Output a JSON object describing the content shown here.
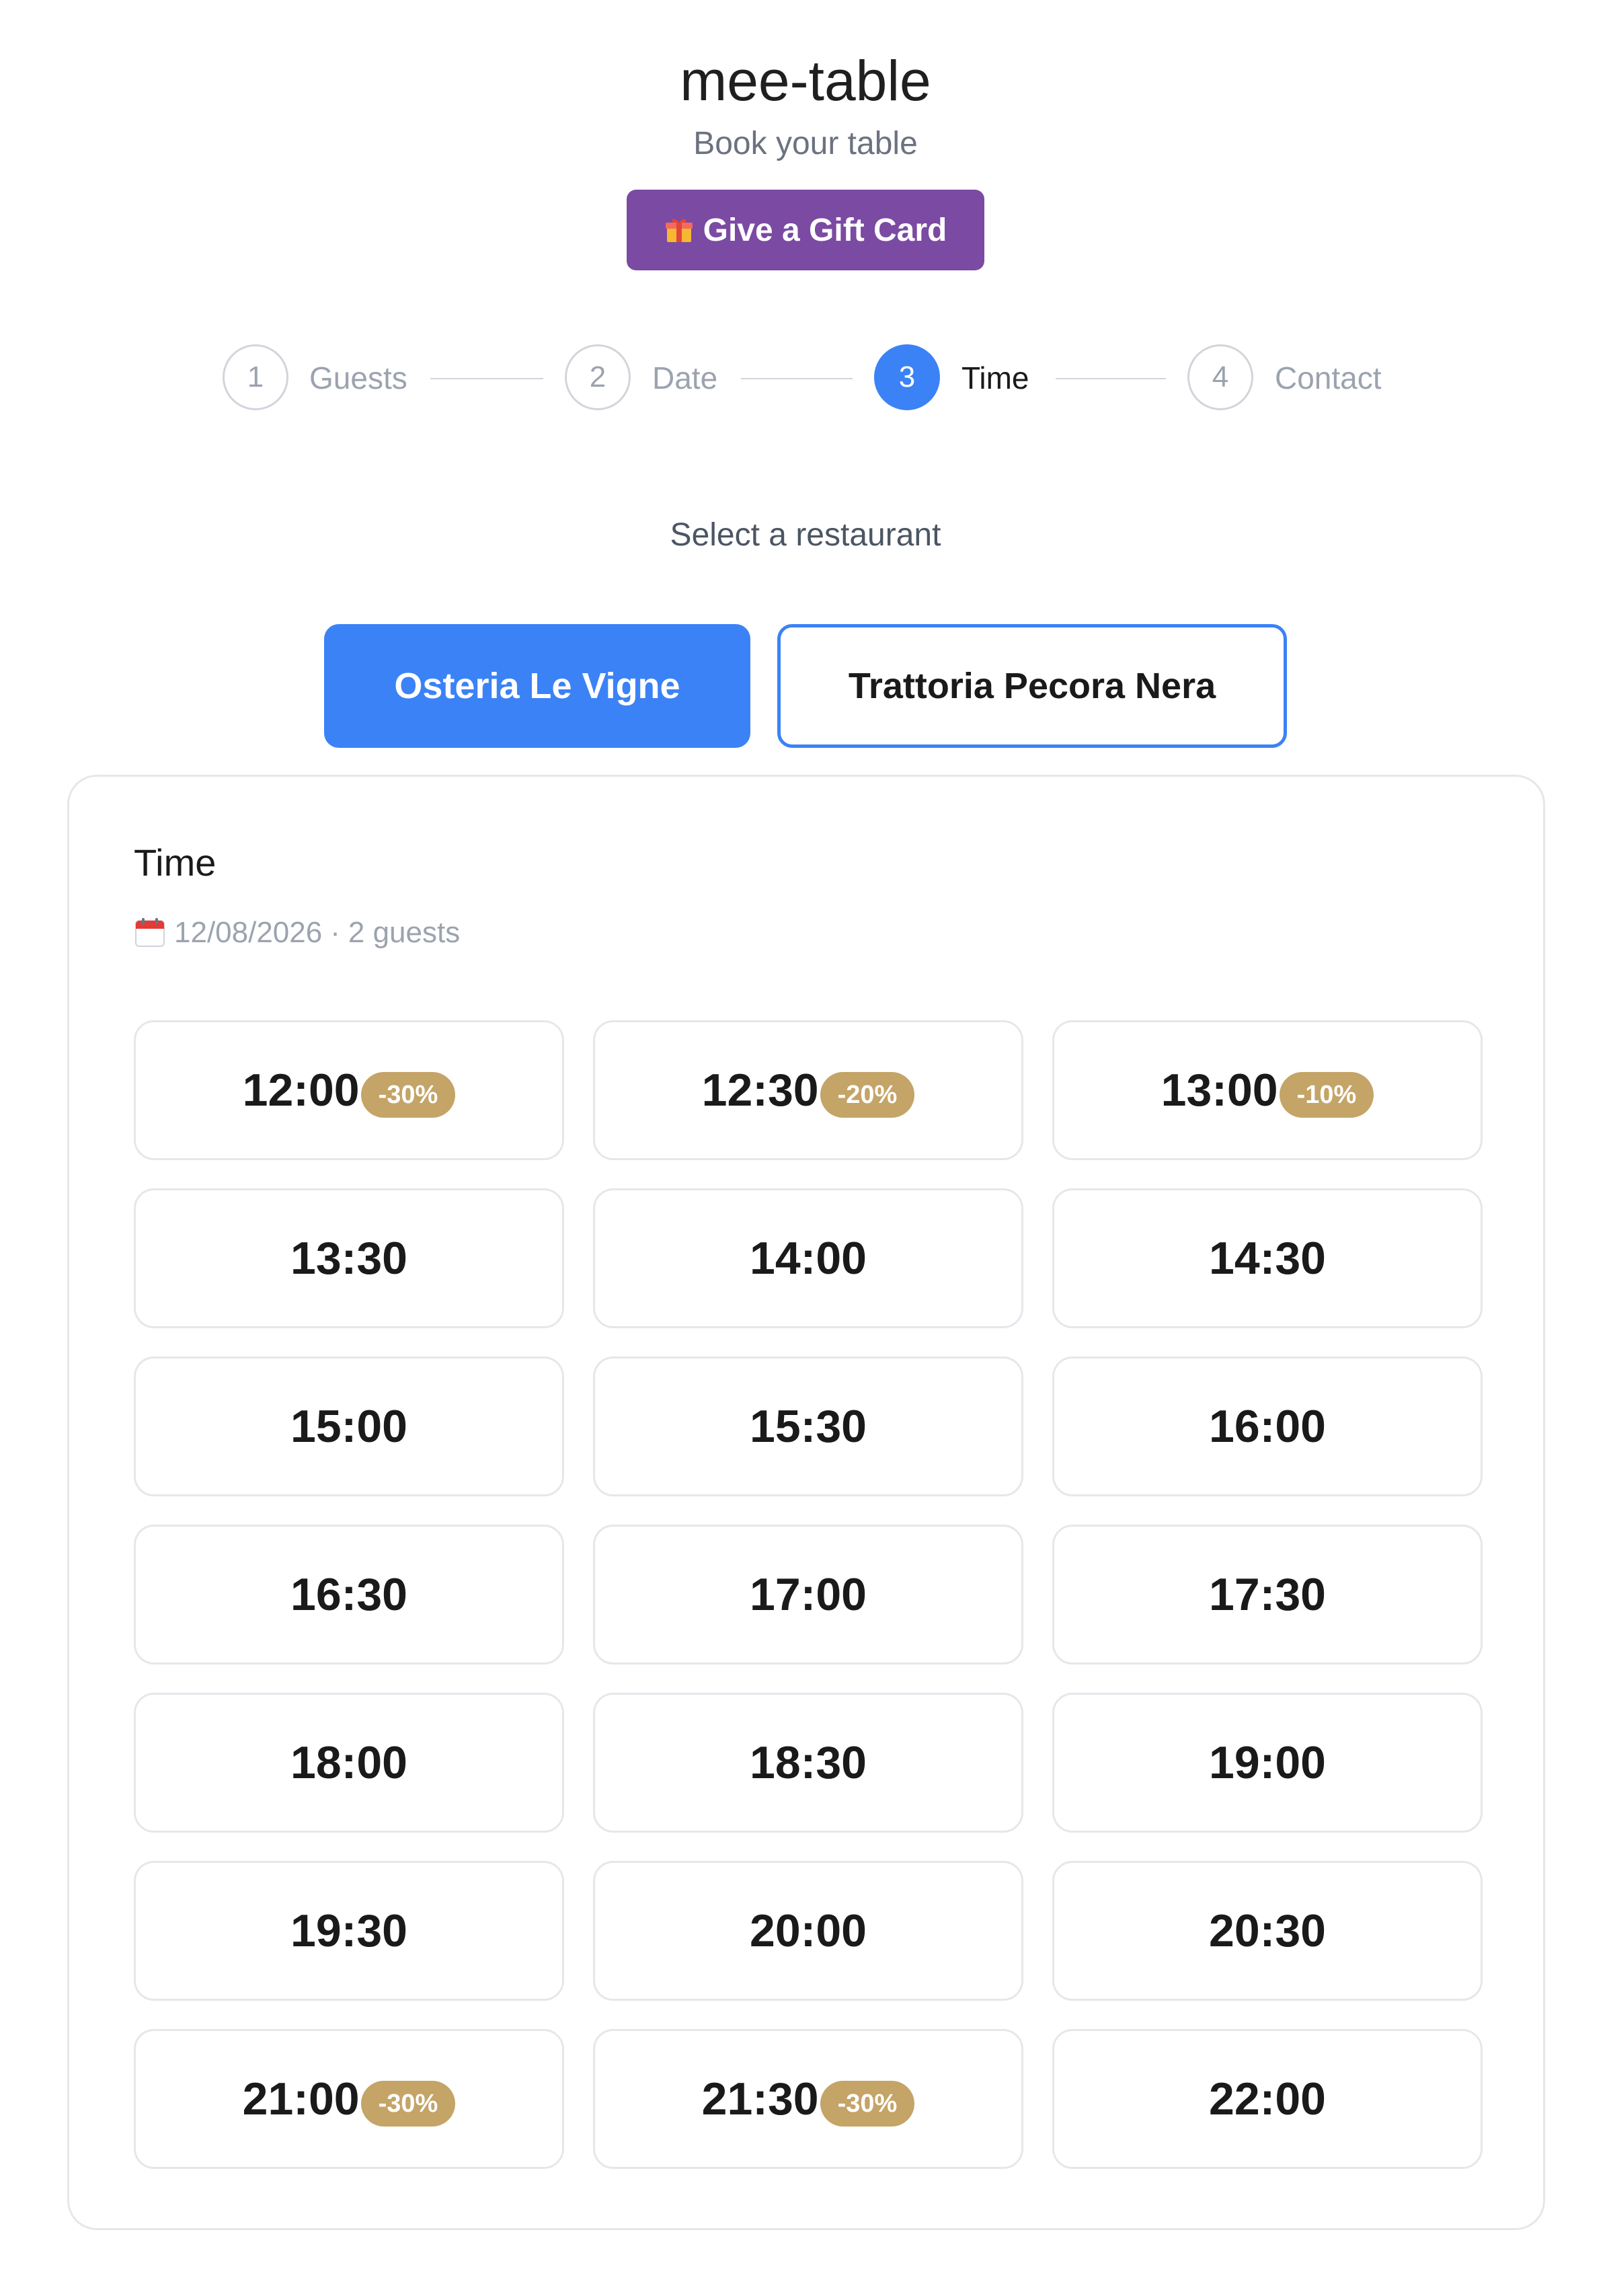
{
  "app": {
    "title": "mee-table",
    "subtitle": "Book your table",
    "gift_label": "Give a Gift Card"
  },
  "stepper": {
    "steps": [
      {
        "number": "1",
        "label": "Guests"
      },
      {
        "number": "2",
        "label": "Date"
      },
      {
        "number": "3",
        "label": "Time"
      },
      {
        "number": "4",
        "label": "Contact"
      }
    ],
    "active_index": 2
  },
  "restaurants": {
    "prompt": "Select a restaurant",
    "options": [
      "Osteria Le Vigne",
      "Trattoria Pecora Nera"
    ],
    "selected": "Osteria Le Vigne"
  },
  "time_card": {
    "title": "Time",
    "date": "12/08/2026",
    "separator": "·",
    "guests": "2 guests",
    "slots": [
      {
        "time": "12:00",
        "discount": "-30%"
      },
      {
        "time": "12:30",
        "discount": "-20%"
      },
      {
        "time": "13:00",
        "discount": "-10%"
      },
      {
        "time": "13:30",
        "discount": ""
      },
      {
        "time": "14:00",
        "discount": ""
      },
      {
        "time": "14:30",
        "discount": ""
      },
      {
        "time": "15:00",
        "discount": ""
      },
      {
        "time": "15:30",
        "discount": ""
      },
      {
        "time": "16:00",
        "discount": ""
      },
      {
        "time": "16:30",
        "discount": ""
      },
      {
        "time": "17:00",
        "discount": ""
      },
      {
        "time": "17:30",
        "discount": ""
      },
      {
        "time": "18:00",
        "discount": ""
      },
      {
        "time": "18:30",
        "discount": ""
      },
      {
        "time": "19:00",
        "discount": ""
      },
      {
        "time": "19:30",
        "discount": ""
      },
      {
        "time": "20:00",
        "discount": ""
      },
      {
        "time": "20:30",
        "discount": ""
      },
      {
        "time": "21:00",
        "discount": "-30%"
      },
      {
        "time": "21:30",
        "discount": "-30%"
      },
      {
        "time": "22:00",
        "discount": ""
      }
    ]
  },
  "colors": {
    "accent": "#3b82f6",
    "gift": "#7b4aa3",
    "badge": "#c4a467"
  },
  "icons": {
    "gift": "gift-icon",
    "calendar": "calendar-icon"
  }
}
